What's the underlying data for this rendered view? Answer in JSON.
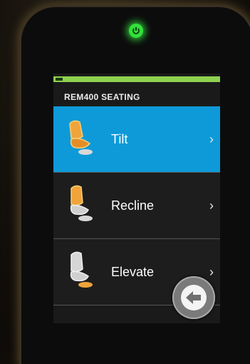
{
  "screen": {
    "title": "REM400 SEATING"
  },
  "status": {
    "battery_level": 1.0,
    "battery_color": "#8ed24f",
    "power_led_color": "#32e03a"
  },
  "menu": {
    "items": [
      {
        "label": "Tilt",
        "icon": "seat-tilt-icon",
        "selected": true
      },
      {
        "label": "Recline",
        "icon": "seat-recline-icon",
        "selected": false
      },
      {
        "label": "Elevate",
        "icon": "seat-elevate-icon",
        "selected": false
      }
    ],
    "chevron": "›",
    "selected_color": "#0e9ad8"
  },
  "controls": {
    "back_icon": "back-arrow-icon"
  }
}
